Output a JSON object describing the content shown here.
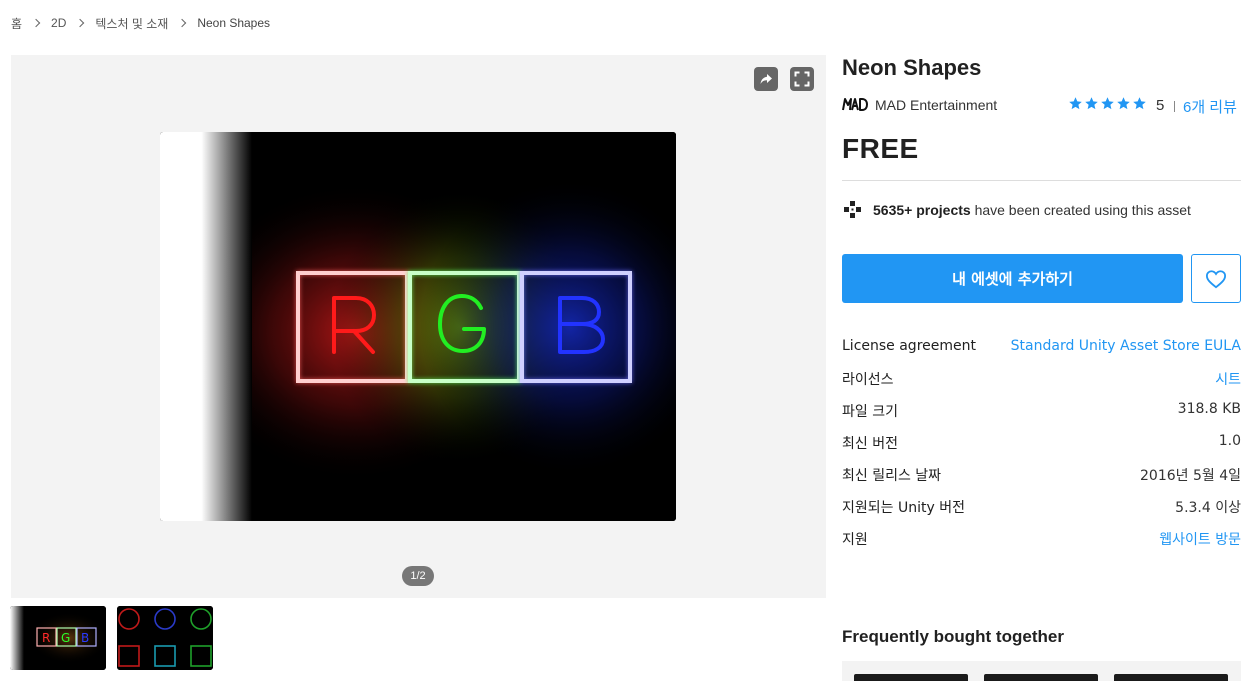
{
  "breadcrumb": {
    "items": [
      "홈",
      "2D",
      "텍스처 및 소재"
    ],
    "current": "Neon Shapes"
  },
  "gallery": {
    "counter": "1/2",
    "share_icon": "share-icon",
    "fullscreen_icon": "fullscreen-icon",
    "main_image": {
      "letters": [
        "R",
        "G",
        "B"
      ],
      "colors": [
        "#ff1a1a",
        "#22ee22",
        "#2233ff"
      ]
    },
    "thumbnails": [
      {
        "letters": [
          "R",
          "G",
          "B"
        ]
      },
      {
        "shapes": [
          "circle",
          "circle",
          "circle",
          "square",
          "square",
          "square"
        ]
      }
    ]
  },
  "product": {
    "title": "Neon Shapes",
    "publisher": "MAD Entertainment",
    "rating": "5",
    "stars": 5,
    "reviews": "6개 리뷰",
    "price": "FREE",
    "projects_count": "5635+ projects",
    "projects_suffix": "have been created using this asset",
    "add_button": "내 에셋에 추가하기",
    "wishlist_icon": "heart-icon"
  },
  "info": {
    "license_agreement_label": "License agreement",
    "license_agreement_value": "Standard Unity Asset Store EULA",
    "license_label": "라이선스",
    "license_value": "시트",
    "file_size_label": "파일 크기",
    "file_size_value": "318.8 KB",
    "latest_version_label": "최신 버전",
    "latest_version_value": "1.0",
    "release_date_label": "최신 릴리스 날짜",
    "release_date_value": "2016년 5월 4일",
    "unity_version_label": "지원되는 Unity 버전",
    "unity_version_value": "5.3.4 이상",
    "support_label": "지원",
    "support_value": "웹사이트 방문"
  },
  "fbt": {
    "title": "Frequently bought together"
  },
  "colors": {
    "accent": "#2196f3",
    "star": "#2196f3"
  }
}
